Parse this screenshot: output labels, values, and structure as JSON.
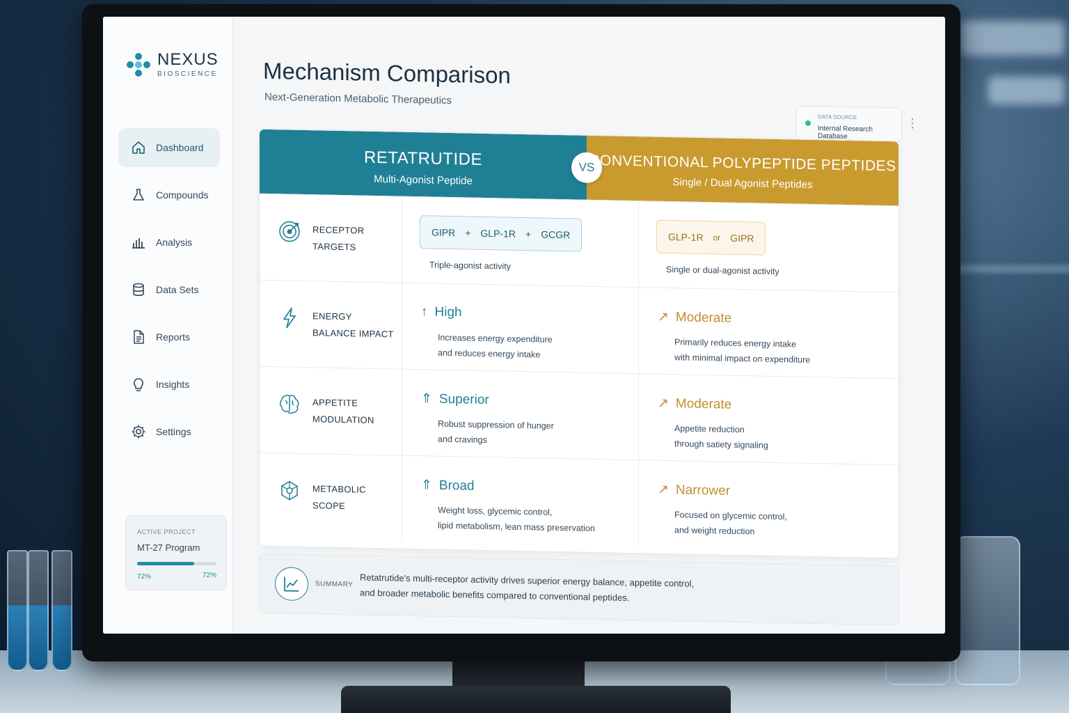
{
  "brand": {
    "name": "NEXUS",
    "sub": "BIOSCIENCE"
  },
  "nav": [
    {
      "label": "Dashboard",
      "icon": "home-icon"
    },
    {
      "label": "Compounds",
      "icon": "flask-icon"
    },
    {
      "label": "Analysis",
      "icon": "bar-chart-icon"
    },
    {
      "label": "Data Sets",
      "icon": "database-icon"
    },
    {
      "label": "Reports",
      "icon": "document-icon"
    },
    {
      "label": "Insights",
      "icon": "lightbulb-icon"
    },
    {
      "label": "Settings",
      "icon": "gear-icon"
    }
  ],
  "project": {
    "label": "ACTIVE PROJECT",
    "name": "MT-27 Program",
    "progress_left": "72%",
    "progress_right": "72%",
    "progress": 0.72
  },
  "header": {
    "title": "Mechanism Comparison",
    "subtitle": "Next-Generation Metabolic Therapeutics"
  },
  "source": {
    "label": "DATA SOURCE",
    "value": "Internal Research Database"
  },
  "compare": {
    "left": {
      "title": "RETATRUTIDE",
      "subtitle": "Multi-Agonist Peptide"
    },
    "vs": "VS",
    "right": {
      "title": "CONVENTIONAL POLYPEPTIDE PEPTIDES",
      "subtitle": "Single / Dual Agonist Peptides"
    }
  },
  "rows": [
    {
      "label": "RECEPTOR TARGETS",
      "left": {
        "chips": [
          "GIPR",
          "+",
          "GLP-1R",
          "+",
          "GCGR"
        ],
        "desc": "Triple-agonist activity"
      },
      "right": {
        "chips": [
          "GLP-1R",
          "or",
          "GIPR"
        ],
        "desc": "Single or dual-agonist activity"
      }
    },
    {
      "label": "ENERGY BALANCE IMPACT",
      "left": {
        "value": "High",
        "desc1": "Increases energy expenditure",
        "desc2": "and reduces energy intake"
      },
      "right": {
        "value": "Moderate",
        "desc1": "Primarily reduces energy intake",
        "desc2": "with minimal impact on expenditure"
      }
    },
    {
      "label": "APPETITE MODULATION",
      "left": {
        "value": "Superior",
        "desc1": "Robust suppression of hunger",
        "desc2": "and cravings"
      },
      "right": {
        "value": "Moderate",
        "desc1": "Appetite reduction",
        "desc2": "through satiety signaling"
      }
    },
    {
      "label": "METABOLIC SCOPE",
      "left": {
        "value": "Broad",
        "desc1": "Weight loss, glycemic control,",
        "desc2": "lipid metabolism, lean mass preservation"
      },
      "right": {
        "value": "Narrower",
        "desc1": "Focused on glycemic control,",
        "desc2": "and weight reduction"
      }
    }
  ],
  "summary": {
    "label": "SUMMARY",
    "line1": "Retatrutide's multi-receptor activity drives superior energy balance, appetite control,",
    "line2": "and broader metabolic benefits compared to conventional peptides."
  },
  "colors": {
    "teal": "#1f7f95",
    "gold": "#c99a2e"
  }
}
